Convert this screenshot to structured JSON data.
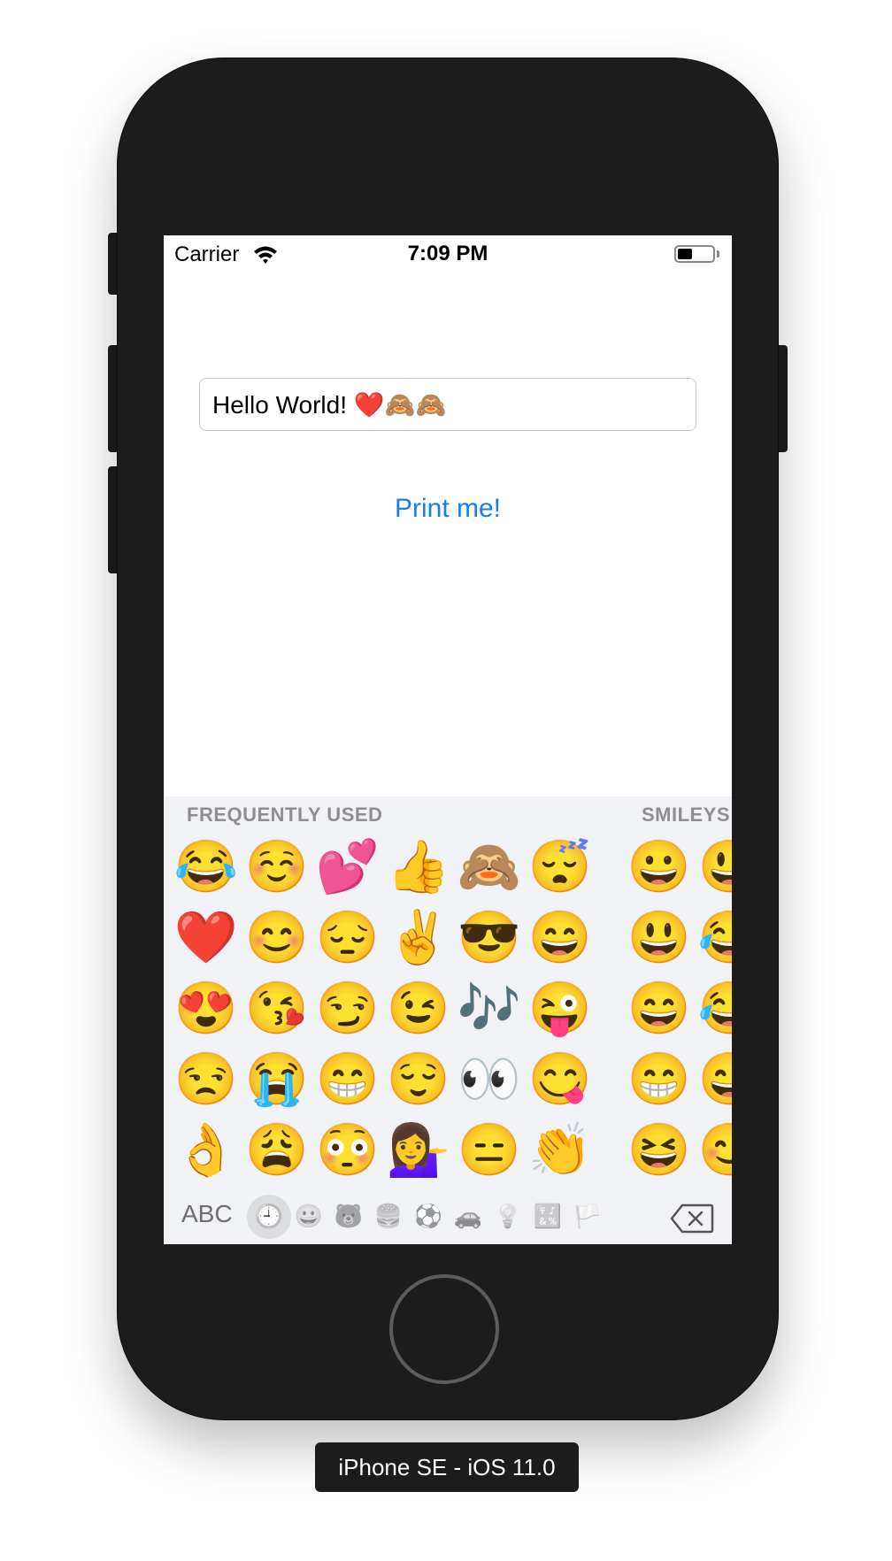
{
  "status_bar": {
    "carrier": "Carrier",
    "time": "7:09 PM"
  },
  "text_field": {
    "value": "Hello World! ❤️🙈🙈"
  },
  "print_button": {
    "label": "Print me!"
  },
  "keyboard": {
    "section_frequent": "FREQUENTLY USED",
    "section_smileys": "SMILEYS",
    "frequent_emojis": [
      "😂",
      "☺️",
      "💕",
      "👍",
      "🙈",
      "😴",
      "❤️",
      "😊",
      "😔",
      "✌️",
      "😎",
      "😄",
      "😍",
      "😘",
      "😏",
      "😉",
      "🎶",
      "😜",
      "😒",
      "😭",
      "😁",
      "😌",
      "👀",
      "😋",
      "👌",
      "😩",
      "😳",
      "💁‍♀️",
      "😑",
      "👏"
    ],
    "smiley_emojis": [
      "😀",
      "😃",
      "😃",
      "😂",
      "😄",
      "😂",
      "😁",
      "😅",
      "😆",
      "😊"
    ],
    "abc_label": "ABC",
    "categories": [
      "clock-icon",
      "smiley-icon",
      "animal-icon",
      "food-icon",
      "ball-icon",
      "car-icon",
      "bulb-icon",
      "symbols-icon",
      "flag-icon"
    ],
    "active_category": "clock-icon"
  },
  "device_label": "iPhone SE - iOS 11.0",
  "colors": {
    "link_blue": "#1a7ee8",
    "device_body": "#1c1c1c",
    "keyboard_bg": "#f1f2f5"
  }
}
